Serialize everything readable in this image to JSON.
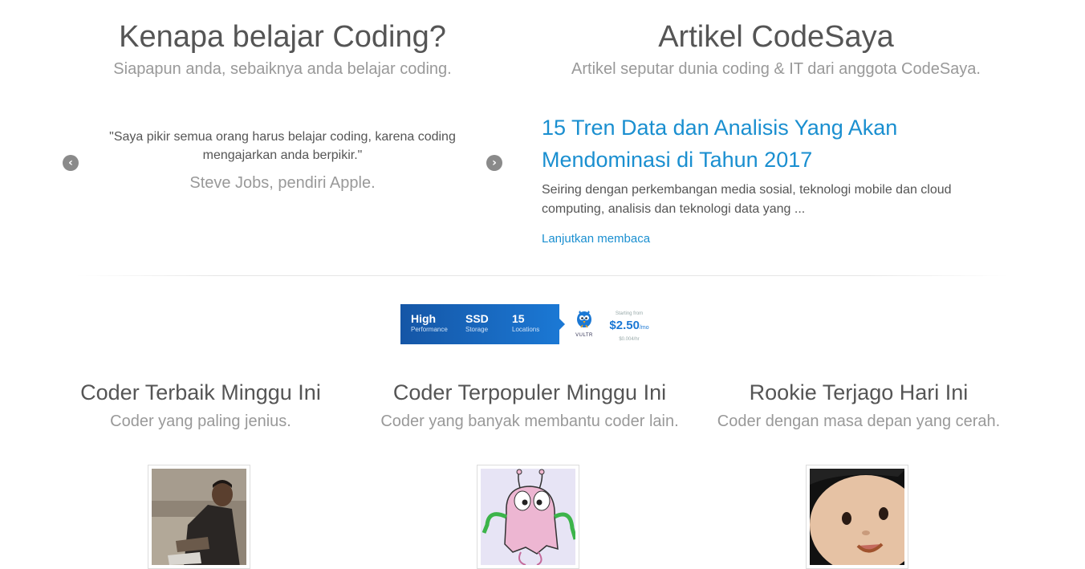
{
  "why_coding": {
    "title": "Kenapa belajar Coding?",
    "subtitle": "Siapapun anda, sebaiknya anda belajar coding.",
    "quote_line1": "\"Saya pikir semua orang harus belajar coding, karena coding",
    "quote_line2": "mengajarkan anda berpikir.\"",
    "author": "Steve Jobs, pendiri Apple.",
    "prev_icon": "chevron-left-icon",
    "next_icon": "chevron-right-icon"
  },
  "articles": {
    "title": "Artikel CodeSaya",
    "subtitle": "Artikel seputar dunia coding & IT dari anggota CodeSaya.",
    "headline_line1": "15 Tren Data dan Analisis Yang Akan",
    "headline_line2": "Mendominasi di Tahun 2017",
    "excerpt_line1": "Seiring dengan perkembangan media sosial, teknologi mobile dan cloud",
    "excerpt_line2": "computing, analisis dan teknologi data yang ...",
    "read_more": "Lanjutkan membaca"
  },
  "ad": {
    "items": [
      {
        "big": "High",
        "small": "Performance"
      },
      {
        "big": "SSD",
        "small": "Storage"
      },
      {
        "big": "15",
        "small": "Locations"
      }
    ],
    "brand": "VULTR",
    "price_label": "Starting from",
    "price": "$2.50",
    "price_unit": "/mo",
    "price_hourly": "$0.004/hr",
    "colors": {
      "accent": "#1b78d4",
      "dark": "#1556a6"
    }
  },
  "leaderboards": [
    {
      "title": "Coder Terbaik Minggu Ini",
      "subtitle": "Coder yang paling jenius."
    },
    {
      "title": "Coder Terpopuler Minggu Ini",
      "subtitle": "Coder yang banyak membantu coder lain."
    },
    {
      "title": "Rookie Terjago Hari Ini",
      "subtitle": "Coder dengan masa depan yang cerah."
    }
  ],
  "colors": {
    "link": "#1a8fd0",
    "heading": "#555555",
    "muted": "#999999"
  }
}
